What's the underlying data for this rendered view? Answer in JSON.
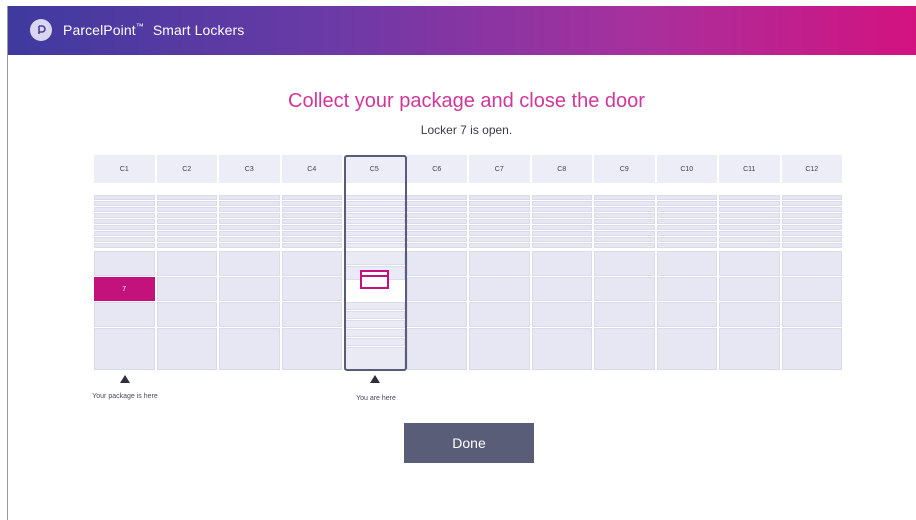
{
  "header": {
    "brand": "ParcelPoint",
    "trademark": "™",
    "product": "Smart Lockers",
    "logo_icon": "parcelpoint-logo-icon"
  },
  "main": {
    "title": "Collect your package and close the door",
    "subtitle": "Locker 7 is open."
  },
  "locker_grid": {
    "columns": [
      "C1",
      "C2",
      "C3",
      "C4",
      "C5",
      "C6",
      "C7",
      "C8",
      "C9",
      "C10",
      "C11",
      "C12"
    ],
    "open_locker": {
      "column": "C1",
      "number": "7"
    },
    "current_column": "C5"
  },
  "markers": {
    "package": "Your package is here",
    "you": "You are here"
  },
  "actions": {
    "done_label": "Done"
  },
  "colors": {
    "accent_magenta": "#c4127c",
    "title_pink": "#d2369b",
    "button_slate": "#5a5d78"
  }
}
